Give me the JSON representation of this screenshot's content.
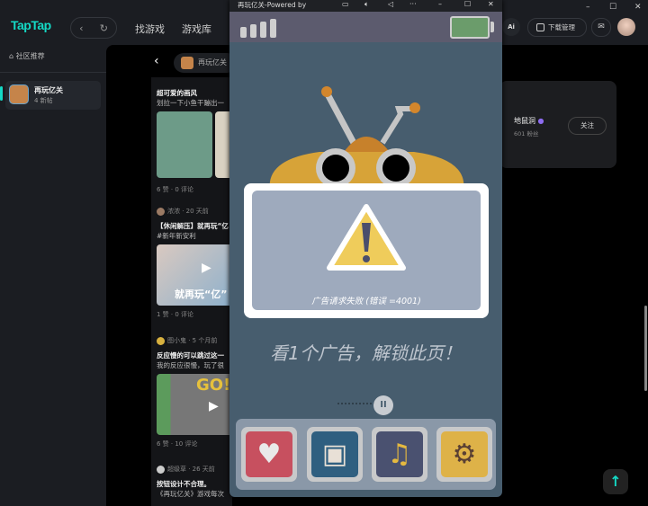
{
  "app": {
    "logo": "TapTap",
    "nav": [
      "找游戏",
      "游戏库"
    ],
    "ai": "Ai",
    "download": "下载管理"
  },
  "sidebar": {
    "home": "社区推荐",
    "game": {
      "name": "再玩亿关",
      "posts": "4 新帖"
    }
  },
  "header": {
    "game_pill": "再玩亿关"
  },
  "feed": [
    {
      "title": "超可爱的画风",
      "desc": "划拉一下小鱼干蹦出一",
      "stats": "6 赞 · 0 评论"
    },
    {
      "author": "浓浓 · 20 天前",
      "title": "【休闲解压】就再玩“亿",
      "desc": "#新年新安利",
      "image_text": "就再玩“亿”",
      "stats": "1 赞 · 0 评论"
    },
    {
      "author": "图小鬼 · 5 个月前",
      "title": "反应慢的可以跳过这一",
      "desc": "我的反应很慢，玩了很",
      "image_text": "GO!",
      "stats": "6 赞 · 10 评论"
    },
    {
      "author": "超级草 · 26 天前",
      "title": "按钮设计不合理。",
      "desc": "《再玩亿关》游戏每次"
    }
  ],
  "developer": {
    "name": "地鼠洞",
    "fans": "601 粉丝",
    "follow": "关注"
  },
  "game_window": {
    "title": "再玩亿关-Powered by",
    "error": "广告请求失败 (错误 =4001)",
    "unlock": "看1个广告，解锁此页！",
    "pause": "II"
  },
  "colors": {
    "accent": "#14d9c5",
    "game_bg": "#475d6e"
  }
}
